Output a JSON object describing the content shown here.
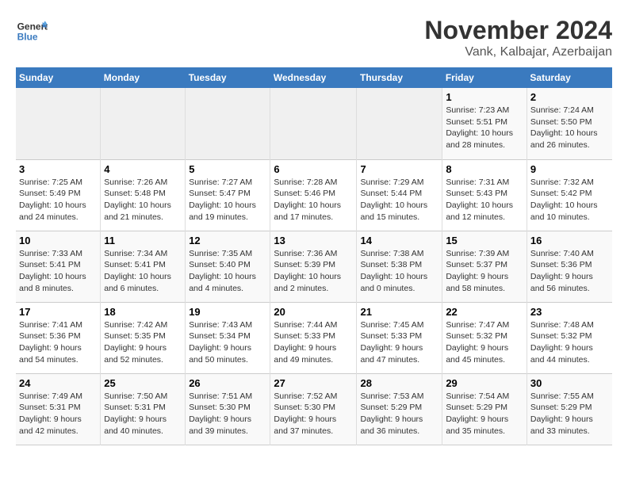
{
  "header": {
    "logo_line1": "General",
    "logo_line2": "Blue",
    "month": "November 2024",
    "location": "Vank, Kalbajar, Azerbaijan"
  },
  "weekdays": [
    "Sunday",
    "Monday",
    "Tuesday",
    "Wednesday",
    "Thursday",
    "Friday",
    "Saturday"
  ],
  "weeks": [
    [
      {
        "day": "",
        "info": ""
      },
      {
        "day": "",
        "info": ""
      },
      {
        "day": "",
        "info": ""
      },
      {
        "day": "",
        "info": ""
      },
      {
        "day": "",
        "info": ""
      },
      {
        "day": "1",
        "info": "Sunrise: 7:23 AM\nSunset: 5:51 PM\nDaylight: 10 hours\nand 28 minutes."
      },
      {
        "day": "2",
        "info": "Sunrise: 7:24 AM\nSunset: 5:50 PM\nDaylight: 10 hours\nand 26 minutes."
      }
    ],
    [
      {
        "day": "3",
        "info": "Sunrise: 7:25 AM\nSunset: 5:49 PM\nDaylight: 10 hours\nand 24 minutes."
      },
      {
        "day": "4",
        "info": "Sunrise: 7:26 AM\nSunset: 5:48 PM\nDaylight: 10 hours\nand 21 minutes."
      },
      {
        "day": "5",
        "info": "Sunrise: 7:27 AM\nSunset: 5:47 PM\nDaylight: 10 hours\nand 19 minutes."
      },
      {
        "day": "6",
        "info": "Sunrise: 7:28 AM\nSunset: 5:46 PM\nDaylight: 10 hours\nand 17 minutes."
      },
      {
        "day": "7",
        "info": "Sunrise: 7:29 AM\nSunset: 5:44 PM\nDaylight: 10 hours\nand 15 minutes."
      },
      {
        "day": "8",
        "info": "Sunrise: 7:31 AM\nSunset: 5:43 PM\nDaylight: 10 hours\nand 12 minutes."
      },
      {
        "day": "9",
        "info": "Sunrise: 7:32 AM\nSunset: 5:42 PM\nDaylight: 10 hours\nand 10 minutes."
      }
    ],
    [
      {
        "day": "10",
        "info": "Sunrise: 7:33 AM\nSunset: 5:41 PM\nDaylight: 10 hours\nand 8 minutes."
      },
      {
        "day": "11",
        "info": "Sunrise: 7:34 AM\nSunset: 5:41 PM\nDaylight: 10 hours\nand 6 minutes."
      },
      {
        "day": "12",
        "info": "Sunrise: 7:35 AM\nSunset: 5:40 PM\nDaylight: 10 hours\nand 4 minutes."
      },
      {
        "day": "13",
        "info": "Sunrise: 7:36 AM\nSunset: 5:39 PM\nDaylight: 10 hours\nand 2 minutes."
      },
      {
        "day": "14",
        "info": "Sunrise: 7:38 AM\nSunset: 5:38 PM\nDaylight: 10 hours\nand 0 minutes."
      },
      {
        "day": "15",
        "info": "Sunrise: 7:39 AM\nSunset: 5:37 PM\nDaylight: 9 hours\nand 58 minutes."
      },
      {
        "day": "16",
        "info": "Sunrise: 7:40 AM\nSunset: 5:36 PM\nDaylight: 9 hours\nand 56 minutes."
      }
    ],
    [
      {
        "day": "17",
        "info": "Sunrise: 7:41 AM\nSunset: 5:36 PM\nDaylight: 9 hours\nand 54 minutes."
      },
      {
        "day": "18",
        "info": "Sunrise: 7:42 AM\nSunset: 5:35 PM\nDaylight: 9 hours\nand 52 minutes."
      },
      {
        "day": "19",
        "info": "Sunrise: 7:43 AM\nSunset: 5:34 PM\nDaylight: 9 hours\nand 50 minutes."
      },
      {
        "day": "20",
        "info": "Sunrise: 7:44 AM\nSunset: 5:33 PM\nDaylight: 9 hours\nand 49 minutes."
      },
      {
        "day": "21",
        "info": "Sunrise: 7:45 AM\nSunset: 5:33 PM\nDaylight: 9 hours\nand 47 minutes."
      },
      {
        "day": "22",
        "info": "Sunrise: 7:47 AM\nSunset: 5:32 PM\nDaylight: 9 hours\nand 45 minutes."
      },
      {
        "day": "23",
        "info": "Sunrise: 7:48 AM\nSunset: 5:32 PM\nDaylight: 9 hours\nand 44 minutes."
      }
    ],
    [
      {
        "day": "24",
        "info": "Sunrise: 7:49 AM\nSunset: 5:31 PM\nDaylight: 9 hours\nand 42 minutes."
      },
      {
        "day": "25",
        "info": "Sunrise: 7:50 AM\nSunset: 5:31 PM\nDaylight: 9 hours\nand 40 minutes."
      },
      {
        "day": "26",
        "info": "Sunrise: 7:51 AM\nSunset: 5:30 PM\nDaylight: 9 hours\nand 39 minutes."
      },
      {
        "day": "27",
        "info": "Sunrise: 7:52 AM\nSunset: 5:30 PM\nDaylight: 9 hours\nand 37 minutes."
      },
      {
        "day": "28",
        "info": "Sunrise: 7:53 AM\nSunset: 5:29 PM\nDaylight: 9 hours\nand 36 minutes."
      },
      {
        "day": "29",
        "info": "Sunrise: 7:54 AM\nSunset: 5:29 PM\nDaylight: 9 hours\nand 35 minutes."
      },
      {
        "day": "30",
        "info": "Sunrise: 7:55 AM\nSunset: 5:29 PM\nDaylight: 9 hours\nand 33 minutes."
      }
    ]
  ]
}
